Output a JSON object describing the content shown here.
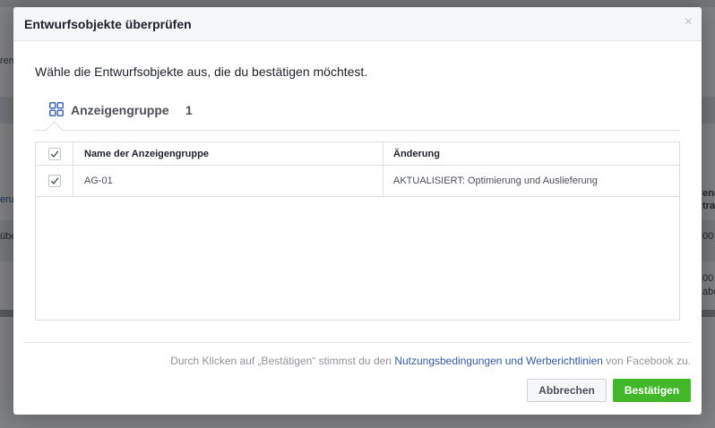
{
  "background": {
    "left_texts": [
      "ren",
      "eru",
      "übe"
    ],
    "right_texts": [
      "ene",
      "tra",
      "00 €",
      "00 €",
      "abe"
    ]
  },
  "dialog": {
    "title": "Entwurfsobjekte überprüfen",
    "close_glyph": "×",
    "instruction": "Wähle die Entwurfsobjekte aus, die du bestätigen möchtest.",
    "tab": {
      "label": "Anzeigengruppe",
      "count": "1",
      "icon": "grid-icon"
    },
    "table": {
      "columns": [
        "Name der Anzeigengruppe",
        "Änderung"
      ],
      "header_checked": true,
      "rows": [
        {
          "checked": true,
          "name": "AG-01",
          "change": "AKTUALISIERT: Optimierung und Auslieferung"
        }
      ]
    },
    "terms": {
      "prefix": "Durch Klicken auf „Bestätigen“ stimmst du den",
      "link": "Nutzungsbedingungen und Werberichtlinien",
      "suffix": "von Facebook zu."
    },
    "buttons": {
      "cancel": "Abbrechen",
      "confirm": "Bestätigen"
    }
  },
  "colors": {
    "confirm_green": "#42b72a",
    "link_blue": "#365899",
    "tab_icon_blue": "#4267b2"
  }
}
